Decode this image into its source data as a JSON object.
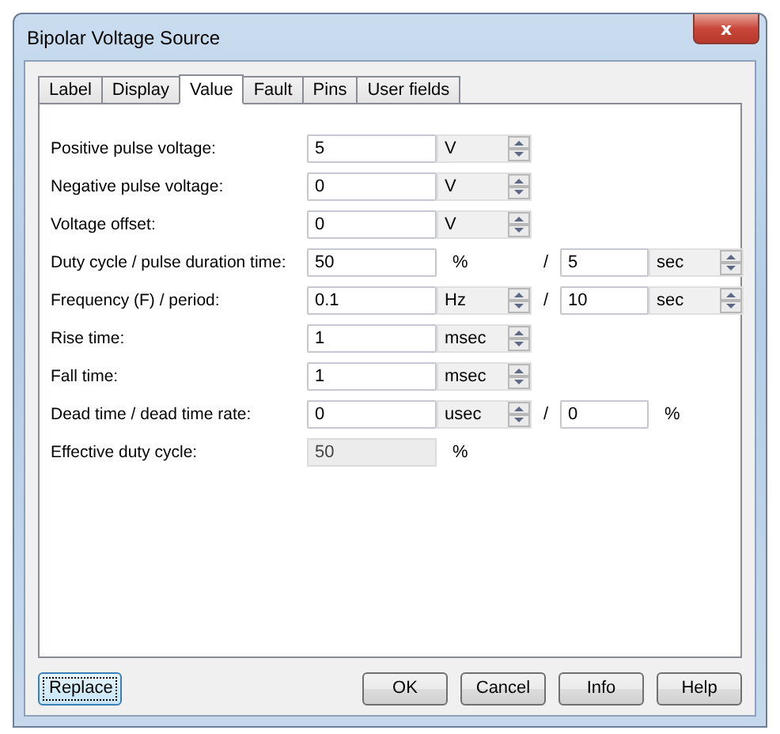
{
  "window": {
    "title": "Bipolar Voltage Source",
    "close": "x"
  },
  "tabs": [
    {
      "label": "Label",
      "selected": false
    },
    {
      "label": "Display",
      "selected": false
    },
    {
      "label": "Value",
      "selected": true
    },
    {
      "label": "Fault",
      "selected": false
    },
    {
      "label": "Pins",
      "selected": false
    },
    {
      "label": "User fields",
      "selected": false
    }
  ],
  "rows": [
    {
      "label": "Positive pulse voltage:",
      "value": "5",
      "unit": {
        "label": "V",
        "kind": "spin"
      },
      "readonly": false
    },
    {
      "label": "Negative pulse voltage:",
      "value": "0",
      "unit": {
        "label": "V",
        "kind": "spin"
      },
      "readonly": false
    },
    {
      "label": "Voltage offset:",
      "value": "0",
      "unit": {
        "label": "V",
        "kind": "spin"
      },
      "readonly": false
    },
    {
      "label": "Duty cycle / pulse duration time:",
      "value": "50",
      "unit": {
        "label": "%",
        "kind": "text"
      },
      "readonly": false,
      "separator": "/",
      "second": {
        "value": "5",
        "unit": {
          "label": "sec",
          "kind": "spin"
        }
      }
    },
    {
      "label": "Frequency (F) / period:",
      "value": "0.1",
      "unit": {
        "label": "Hz",
        "kind": "spin"
      },
      "readonly": false,
      "separator": "/",
      "second": {
        "value": "10",
        "unit": {
          "label": "sec",
          "kind": "spin"
        }
      }
    },
    {
      "label": "Rise time:",
      "value": "1",
      "unit": {
        "label": "msec",
        "kind": "spin"
      },
      "readonly": false
    },
    {
      "label": "Fall time:",
      "value": "1",
      "unit": {
        "label": "msec",
        "kind": "spin"
      },
      "readonly": false
    },
    {
      "label": "Dead time / dead time rate:",
      "value": "0",
      "unit": {
        "label": "usec",
        "kind": "spin"
      },
      "readonly": false,
      "separator": "/",
      "second": {
        "value": "0",
        "unit": {
          "label": "%",
          "kind": "text"
        }
      }
    },
    {
      "label": "Effective duty cycle:",
      "value": "50",
      "unit": {
        "label": "%",
        "kind": "text"
      },
      "readonly": true
    }
  ],
  "left_buttons": [
    {
      "label": "Replace",
      "focused": true
    }
  ],
  "right_buttons": [
    {
      "label": "OK",
      "focused": false
    },
    {
      "label": "Cancel",
      "focused": false
    },
    {
      "label": "Info",
      "focused": false
    },
    {
      "label": "Help",
      "focused": false
    }
  ]
}
